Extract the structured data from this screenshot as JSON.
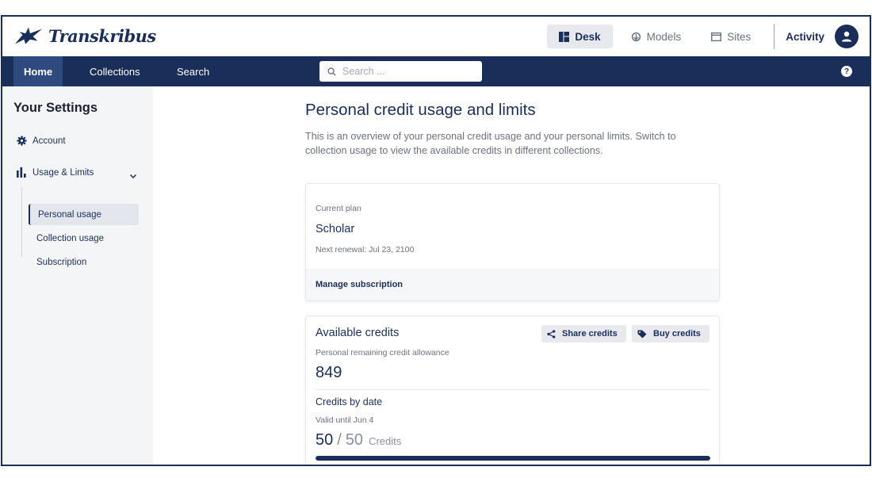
{
  "app": {
    "logo_text": "Transkribus"
  },
  "topnav": {
    "items": [
      {
        "label": "Desk",
        "icon": "desk-icon",
        "active": true
      },
      {
        "label": "Models",
        "icon": "models-icon",
        "active": false
      },
      {
        "label": "Sites",
        "icon": "sites-icon",
        "active": false
      }
    ],
    "activity_label": "Activity"
  },
  "navbar": {
    "items": [
      {
        "label": "Home",
        "active": true
      },
      {
        "label": "Collections",
        "active": false
      },
      {
        "label": "Search",
        "active": false
      }
    ],
    "search_placeholder": "Search ..."
  },
  "sidebar": {
    "title": "Your Settings",
    "account_label": "Account",
    "usage_label": "Usage & Limits",
    "sub_items": [
      {
        "label": "Personal usage",
        "active": true
      },
      {
        "label": "Collection usage",
        "active": false
      },
      {
        "label": "Subscription",
        "active": false
      }
    ]
  },
  "main": {
    "title": "Personal credit usage and limits",
    "intro": "This is an overview of your personal credit usage and your personal limits. Switch to collection usage to view the available credits in different collections.",
    "plan": {
      "label": "Current plan",
      "name": "Scholar",
      "renewal": "Next renewal: Jul 23, 2100",
      "manage_link": "Manage subscription"
    },
    "credits": {
      "title": "Available credits",
      "share_label": "Share credits",
      "buy_label": "Buy credits",
      "remaining_label": "Personal remaining credit allowance",
      "remaining_value": "849",
      "by_date_title": "Credits by date",
      "valid_until": "Valid until Jun 4",
      "used": "50",
      "slash": "/",
      "total": "50",
      "unit": "Credits",
      "progress_fraction": 1.0
    }
  },
  "colors": {
    "brand": "#1a2e5a",
    "accent": "#2f4a7e"
  }
}
